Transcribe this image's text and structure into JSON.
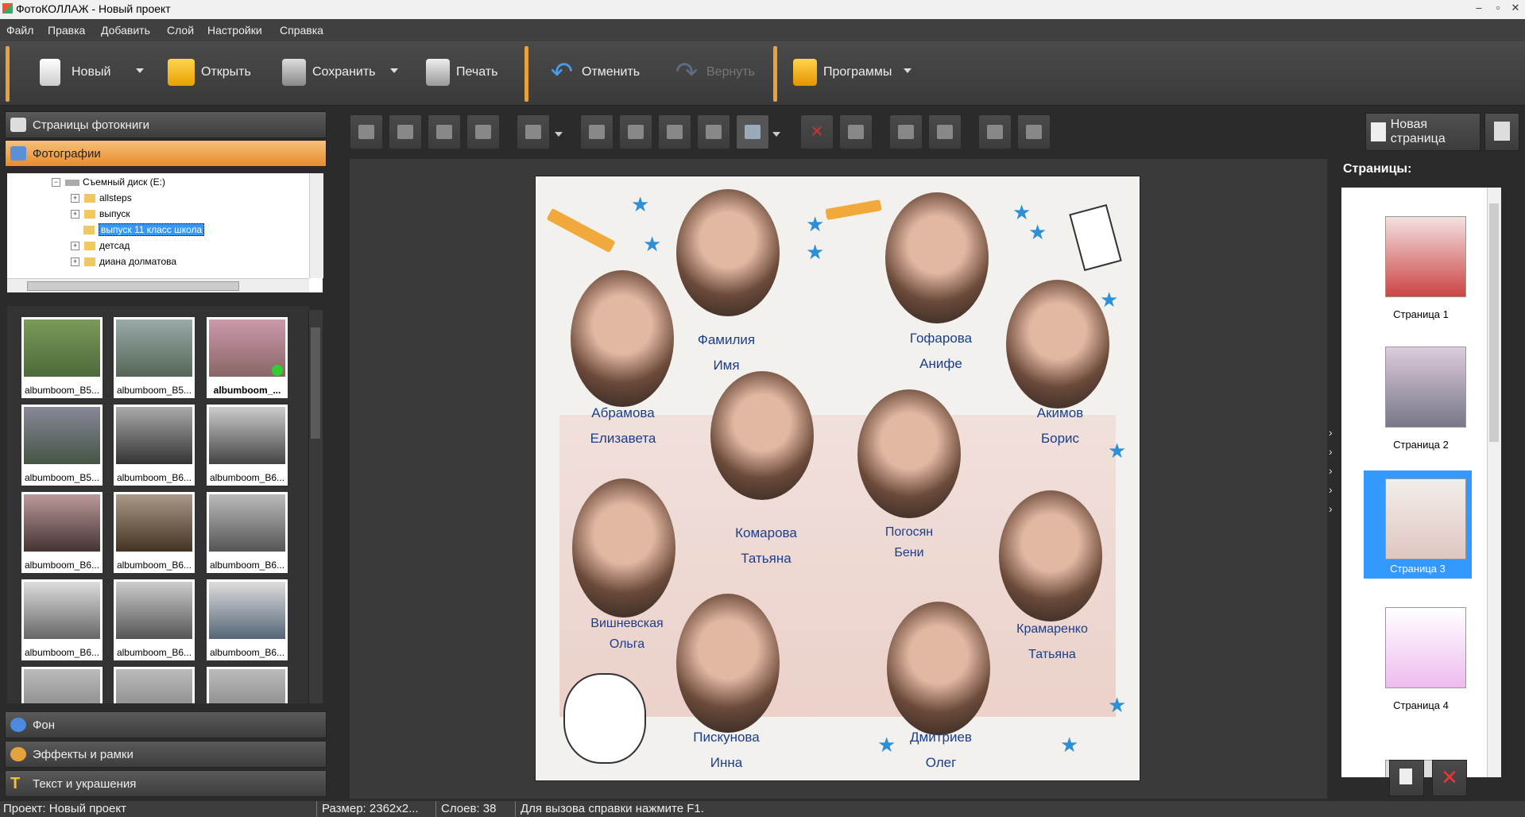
{
  "window": {
    "title": "ФотоКОЛЛАЖ - Новый проект"
  },
  "menu": [
    "Файл",
    "Правка",
    "Добавить",
    "Слой",
    "Настройки",
    "Справка"
  ],
  "toolbar": {
    "new": "Новый",
    "open": "Открыть",
    "save": "Сохранить",
    "print": "Печать",
    "undo": "Отменить",
    "redo": "Вернуть",
    "programs": "Программы"
  },
  "left_panel": {
    "photobook_pages": "Страницы фотокниги",
    "photos": "Фотографии",
    "background": "Фон",
    "effects": "Эффекты и рамки",
    "text": "Текст и украшения"
  },
  "tree": {
    "drive": "Съемный диск (E:)",
    "items": [
      "allsteps",
      "выпуск",
      "выпуск 11 класс школа",
      "детсад",
      "диана долматова"
    ],
    "selected": "выпуск 11 класс школа"
  },
  "thumbnails": [
    "albumboom_B5...",
    "albumboom_B5...",
    "albumboom_...",
    "albumboom_B5...",
    "albumboom_B6...",
    "albumboom_B6...",
    "albumboom_B6...",
    "albumboom_B6...",
    "albumboom_B6...",
    "albumboom_B6...",
    "albumboom_B6...",
    "albumboom_B6..."
  ],
  "new_page_button": "Новая страница",
  "pages": {
    "title": "Страницы:",
    "items": [
      "Страница 1",
      "Страница 2",
      "Страница 3",
      "Страница 4"
    ],
    "selected": "Страница 3"
  },
  "collage_names": [
    [
      "Фамилия",
      "Имя"
    ],
    [
      "Гофарова",
      "Анифе"
    ],
    [
      "Абрамова",
      "Елизавета"
    ],
    [
      "Акимов",
      "Борис"
    ],
    [
      "Комарова",
      "Татьяна"
    ],
    [
      "Погосян",
      "Бени"
    ],
    [
      "Вишневская",
      "Ольга"
    ],
    [
      "Крамаренко",
      "Татьяна"
    ],
    [
      "Пискунова",
      "Инна"
    ],
    [
      "Дмитриев",
      "Олег"
    ]
  ],
  "status": {
    "project": "Проект:  Новый проект",
    "size": "Размер:  2362x2...",
    "layers": "Слоев:  38",
    "help": "Для вызова справки нажмите F1."
  },
  "colors": {
    "accent": "#e88a2c",
    "selection": "#3399ff",
    "name_text": "#1a3e8c",
    "stars": "#2d8fd5"
  }
}
